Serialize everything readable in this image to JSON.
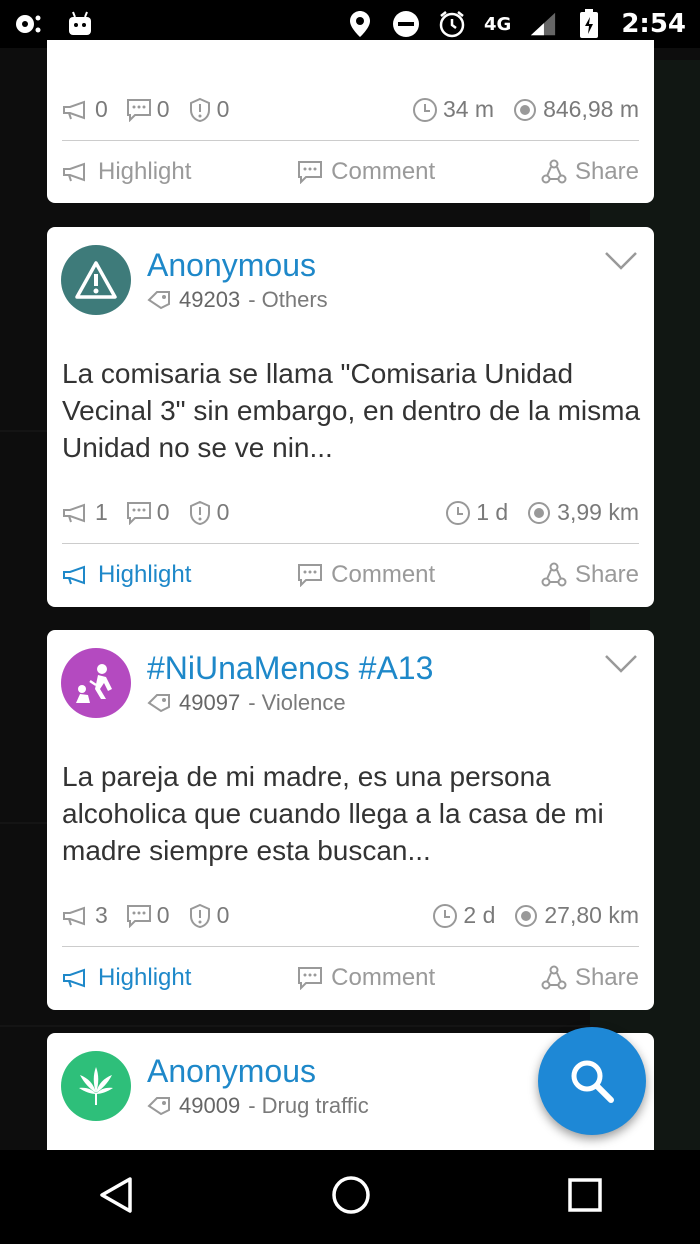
{
  "status_bar": {
    "network": "4G",
    "time": "2:54"
  },
  "cards": [
    {
      "stats": {
        "highlights": "0",
        "comments": "0",
        "reports": "0",
        "time": "34 m",
        "distance": "846,98 m"
      },
      "actions": {
        "highlight": "Highlight",
        "comment": "Comment",
        "share": "Share"
      }
    },
    {
      "title": "Anonymous",
      "id": "49203",
      "category": "- Others",
      "body": "La comisaria se llama \"Comisaria Unidad Vecinal 3\"  sin embargo,  en dentro de la misma Unidad no se ve nin...",
      "avatar_icon": "warning-icon",
      "avatar_color": "#3e7b7a",
      "stats": {
        "highlights": "1",
        "comments": "0",
        "reports": "0",
        "time": "1 d",
        "distance": "3,99 km"
      },
      "actions": {
        "highlight": "Highlight",
        "comment": "Comment",
        "share": "Share"
      }
    },
    {
      "title": "#NiUnaMenos #A13",
      "id": "49097",
      "category": "- Violence",
      "body": "La pareja de mi madre, es una persona alcoholica que cuando llega a la casa de mi madre siempre esta buscan...",
      "avatar_icon": "violence-icon",
      "avatar_color": "#b44ac0",
      "stats": {
        "highlights": "3",
        "comments": "0",
        "reports": "0",
        "time": "2 d",
        "distance": "27,80 km"
      },
      "actions": {
        "highlight": "Highlight",
        "comment": "Comment",
        "share": "Share"
      }
    },
    {
      "title": "Anonymous",
      "id": "49009",
      "category": "- Drug traffic",
      "avatar_icon": "cannabis-leaf-icon",
      "avatar_color": "#2ebf7a"
    }
  ],
  "colors": {
    "accent": "#1e88c9",
    "fab": "#1e88d6"
  }
}
